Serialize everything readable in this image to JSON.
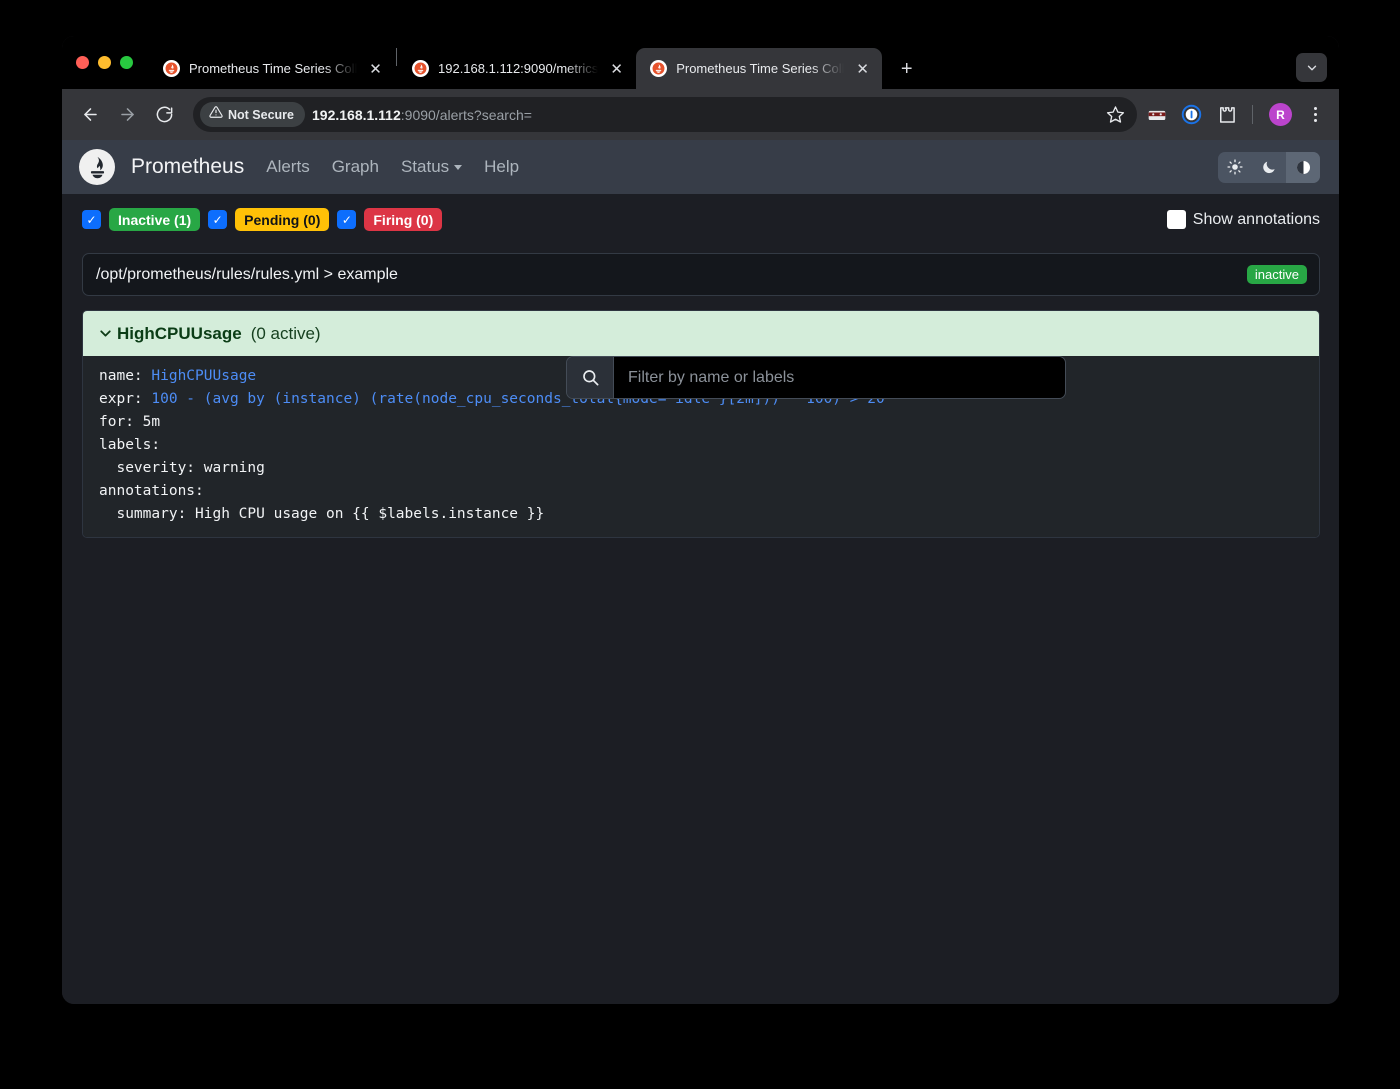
{
  "browser": {
    "tabs": [
      {
        "title": "Prometheus Time Series Colle",
        "favicon": "prometheus-favicon",
        "active": false
      },
      {
        "title": "192.168.1.112:9090/metrics",
        "favicon": "prometheus-favicon",
        "active": false
      },
      {
        "title": "Prometheus Time Series Colle",
        "favicon": "prometheus-favicon",
        "active": true
      }
    ],
    "new_tab_label": "+",
    "tab_close_label": "✕",
    "toolbar": {
      "back_icon": "back-arrow-icon",
      "forward_icon": "forward-arrow-icon",
      "reload_icon": "reload-icon",
      "security_label": "Not Secure",
      "url_host": "192.168.1.112",
      "url_rest": ":9090/alerts?search=",
      "bookmark_icon": "star-icon",
      "extension_icons": [
        "incognito-reader-icon",
        "onepassword-icon",
        "extensions-puzzle-icon"
      ],
      "avatar_initial": "R",
      "menu_icon": "three-dot-menu-icon"
    }
  },
  "prometheus": {
    "brand": "Prometheus",
    "nav": [
      {
        "label": "Alerts",
        "has_caret": false
      },
      {
        "label": "Graph",
        "has_caret": false
      },
      {
        "label": "Status",
        "has_caret": true
      },
      {
        "label": "Help",
        "has_caret": false
      }
    ],
    "theme_buttons": [
      {
        "name": "light-theme",
        "icon": "sun-icon",
        "selected": false
      },
      {
        "name": "dark-theme",
        "icon": "moon-icon",
        "selected": false
      },
      {
        "name": "auto-theme",
        "icon": "half-circle-icon",
        "selected": true
      }
    ],
    "filters": [
      {
        "label": "Inactive (1)",
        "state": "inactive",
        "checked": true,
        "color": "#28a745"
      },
      {
        "label": "Pending (0)",
        "state": "pending",
        "checked": true,
        "color": "#ffc107"
      },
      {
        "label": "Firing (0)",
        "state": "firing",
        "checked": true,
        "color": "#dc3545"
      }
    ],
    "search": {
      "placeholder": "Filter by name or labels",
      "value": "",
      "icon": "search-icon"
    },
    "show_annotations": {
      "label": "Show annotations",
      "checked": false
    },
    "rule_group": {
      "path": "/opt/prometheus/rules/rules.yml > example",
      "state": "inactive"
    },
    "alert": {
      "name": "HighCPUUsage",
      "active_count": "(0 active)",
      "expanded": true,
      "chevron": "chevron-down-icon",
      "yaml": {
        "name_key": "name: ",
        "name_value": "HighCPUUsage",
        "expr_key": "expr: ",
        "expr_value": "100 - (avg by (instance) (rate(node_cpu_seconds_total{mode=\"idle\"}[2m])) * 100) > 20",
        "for_line": "for: 5m",
        "labels_line": "labels:",
        "severity_line": "  severity: warning",
        "annotations_line": "annotations:",
        "summary_line": "  summary: High CPU usage on {{ $labels.instance }}"
      }
    }
  }
}
